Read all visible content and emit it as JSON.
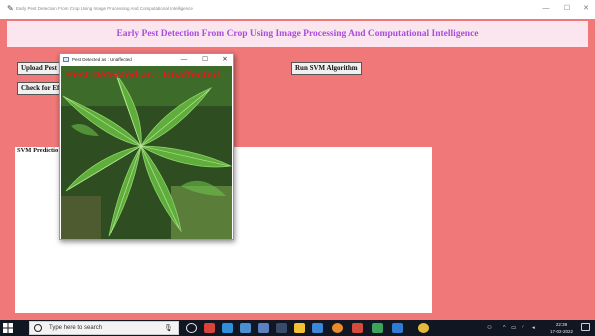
{
  "window": {
    "title": "Early Pest Detection From Crop Using Image Processing And Computational Intelligence",
    "controls": {
      "minimize": "—",
      "maximize": "☐",
      "close": "✕"
    }
  },
  "main": {
    "heading": "Early Pest Detection From Crop Using Image Processing And Computational Intelligence",
    "buttons": {
      "upload": "Upload Pest",
      "check": "Check for Eff",
      "run_svm": "Run SVM Algorithm"
    },
    "svm_label": "SVM Predictio"
  },
  "popup": {
    "title": "Pest Detected as : Unaffected",
    "overlay_text": "Pest Detected as : Unaffected",
    "controls": {
      "minimize": "—",
      "maximize": "☐",
      "close": "✕"
    }
  },
  "taskbar": {
    "search_placeholder": "Type here to search",
    "clock": {
      "time": "22:39",
      "date": "17-02-2022"
    },
    "accent": "#0078d7"
  },
  "colors": {
    "client_bg": "#f07878",
    "heading_bg": "#fbe6ef",
    "heading_text": "#a84ddf",
    "overlay_text": "#e0191e"
  }
}
